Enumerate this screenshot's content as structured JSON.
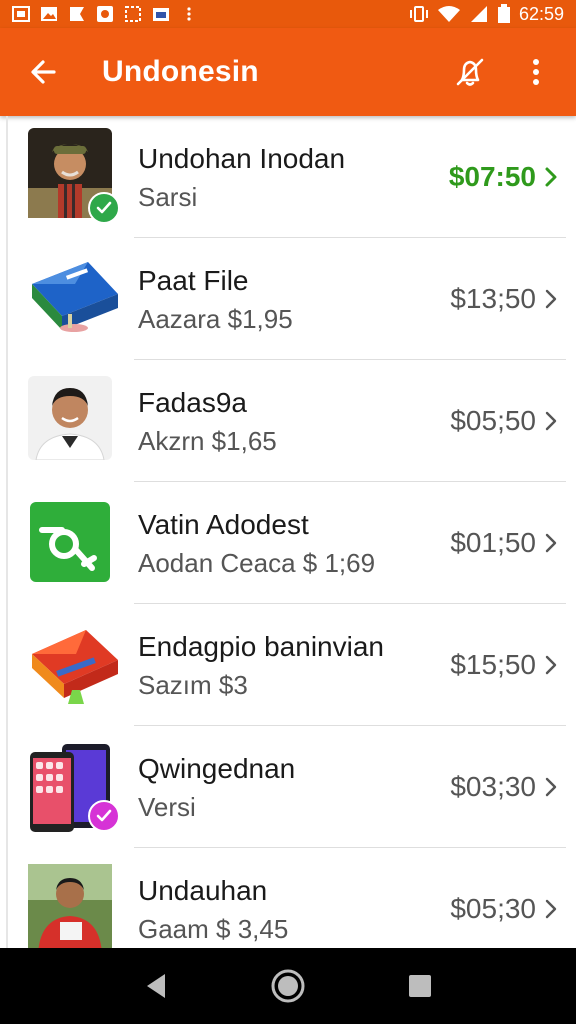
{
  "status_bar": {
    "time": "62:59",
    "icons": [
      "notification-box-icon",
      "image-icon",
      "flag-icon",
      "record-icon",
      "grid-icon",
      "calendar-icon",
      "more-dots-icon"
    ],
    "right_icons": [
      "vibrate-icon",
      "wifi-icon",
      "signal-icon",
      "battery-icon"
    ]
  },
  "app_bar": {
    "title": "Undonesin",
    "back_icon": "arrow-left-icon",
    "actions": [
      "bell-off-icon",
      "more-vert-icon"
    ]
  },
  "colors": {
    "primary": "#f05a12",
    "status": "#e8590c",
    "price_highlight": "#2f9a1c",
    "badge_green": "#2fa84a",
    "badge_magenta": "#d633d6"
  },
  "items": [
    {
      "title": "Undohan Inodan",
      "subtitle": "Sarsi",
      "price": "$07:50",
      "thumb": "portrait-military",
      "badge": "check-green"
    },
    {
      "title": "Paat File",
      "subtitle": "Aazara $1,95",
      "price": "$13;50",
      "thumb": "envelope-blue"
    },
    {
      "title": "Fadas9a",
      "subtitle": "Akzrn $1,65",
      "price": "$05;50",
      "thumb": "portrait-man"
    },
    {
      "title": "Vatin Adodest",
      "subtitle": "Aodan Ceaca $ 1;69",
      "price": "$01;50",
      "thumb": "green-app-icon"
    },
    {
      "title": "Endagpio baninvian",
      "subtitle": "Sazım $3",
      "price": "$15;50",
      "thumb": "envelope-red"
    },
    {
      "title": "Qwingednan",
      "subtitle": "Versi",
      "price": "$03;30",
      "thumb": "phones",
      "badge": "check-magenta"
    },
    {
      "title": "Undauhan",
      "subtitle": "Gaam $ 3,45",
      "price": "$05;30",
      "thumb": "portrait-outdoor"
    }
  ],
  "nav_bar": [
    "back-triangle-icon",
    "home-circle-icon",
    "recents-square-icon"
  ]
}
